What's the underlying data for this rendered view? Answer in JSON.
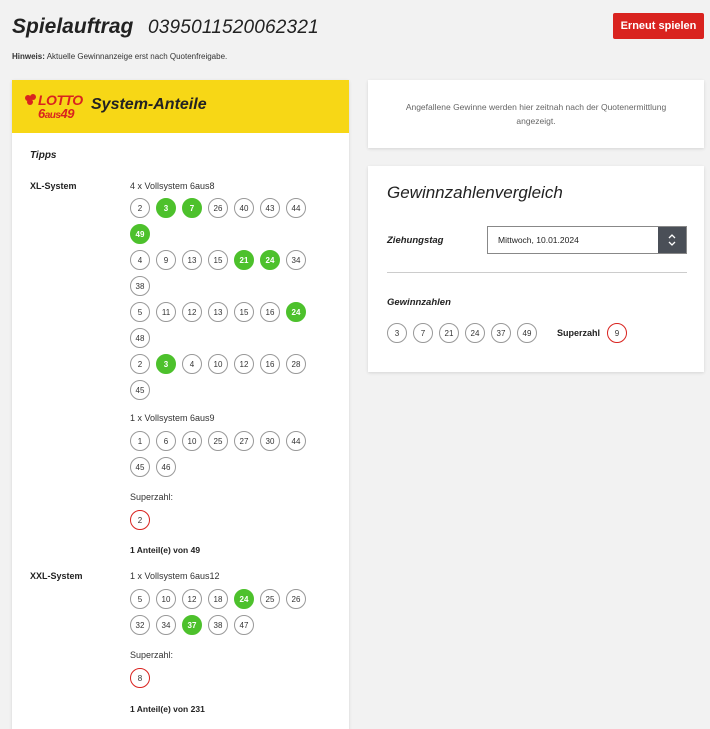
{
  "header": {
    "title": "Spielauftrag",
    "order_number": "0395011520062321",
    "replay_label": "Erneut spielen",
    "hint_bold": "Hinweis:",
    "hint_text": " Aktuelle Gewinnanzeige erst nach Quotenfreigabe."
  },
  "left_card": {
    "logo_word": "LOTTO",
    "logo_six": "6",
    "logo_aus": "aus",
    "logo_49": "49",
    "title": "System-Anteile",
    "tipps_label": "Tipps",
    "xl_label": "XL-System",
    "xl_desc1": "4 x Vollsystem 6aus8",
    "xl_rows": [
      [
        {
          "n": "2",
          "hit": false
        },
        {
          "n": "3",
          "hit": true
        },
        {
          "n": "7",
          "hit": true
        },
        {
          "n": "26",
          "hit": false
        },
        {
          "n": "40",
          "hit": false
        },
        {
          "n": "43",
          "hit": false
        },
        {
          "n": "44",
          "hit": false
        },
        {
          "n": "49",
          "hit": true
        }
      ],
      [
        {
          "n": "4",
          "hit": false
        },
        {
          "n": "9",
          "hit": false
        },
        {
          "n": "13",
          "hit": false
        },
        {
          "n": "15",
          "hit": false
        },
        {
          "n": "21",
          "hit": true
        },
        {
          "n": "24",
          "hit": true
        },
        {
          "n": "34",
          "hit": false
        },
        {
          "n": "38",
          "hit": false
        }
      ],
      [
        {
          "n": "5",
          "hit": false
        },
        {
          "n": "11",
          "hit": false
        },
        {
          "n": "12",
          "hit": false
        },
        {
          "n": "13",
          "hit": false
        },
        {
          "n": "15",
          "hit": false
        },
        {
          "n": "16",
          "hit": false
        },
        {
          "n": "24",
          "hit": true
        },
        {
          "n": "48",
          "hit": false
        }
      ],
      [
        {
          "n": "2",
          "hit": false
        },
        {
          "n": "3",
          "hit": true
        },
        {
          "n": "4",
          "hit": false
        },
        {
          "n": "10",
          "hit": false
        },
        {
          "n": "12",
          "hit": false
        },
        {
          "n": "16",
          "hit": false
        },
        {
          "n": "28",
          "hit": false
        },
        {
          "n": "45",
          "hit": false
        }
      ]
    ],
    "xl_desc2": "1 x Vollsystem 6aus9",
    "xl_row9": [
      {
        "n": "1",
        "hit": false
      },
      {
        "n": "6",
        "hit": false
      },
      {
        "n": "10",
        "hit": false
      },
      {
        "n": "25",
        "hit": false
      },
      {
        "n": "27",
        "hit": false
      },
      {
        "n": "30",
        "hit": false
      },
      {
        "n": "44",
        "hit": false
      },
      {
        "n": "45",
        "hit": false
      },
      {
        "n": "46",
        "hit": false
      }
    ],
    "xl_superzahl_label": "Superzahl:",
    "xl_superzahl": "2",
    "xl_share": "1 Anteil(e) von 49",
    "xxl_label": "XXL-System",
    "xxl_desc": "1 x Vollsystem 6aus12",
    "xxl_numbers": [
      {
        "n": "5",
        "hit": false
      },
      {
        "n": "10",
        "hit": false
      },
      {
        "n": "12",
        "hit": false
      },
      {
        "n": "18",
        "hit": false
      },
      {
        "n": "24",
        "hit": true
      },
      {
        "n": "25",
        "hit": false
      },
      {
        "n": "26",
        "hit": false
      },
      {
        "n": "32",
        "hit": false
      },
      {
        "n": "34",
        "hit": false
      },
      {
        "n": "37",
        "hit": true
      },
      {
        "n": "38",
        "hit": false
      },
      {
        "n": "47",
        "hit": false
      }
    ],
    "xxl_superzahl_label": "Superzahl:",
    "xxl_superzahl": "8",
    "xxl_share": "1 Anteil(e) von 231"
  },
  "info_card": {
    "text": "Angefallene Gewinne werden hier zeitnah nach der Quotenermittlung angezeigt."
  },
  "compare": {
    "title": "Gewinnzahlenvergleich",
    "draw_label": "Ziehungstag",
    "draw_value": "Mittwoch, 10.01.2024",
    "numbers_label": "Gewinnzahlen",
    "numbers": [
      "3",
      "7",
      "21",
      "24",
      "37",
      "49"
    ],
    "superzahl_label": "Superzahl",
    "superzahl": "9"
  },
  "colors": {
    "hit": "#4dc12c",
    "brand_red": "#d9231f",
    "brand_yellow": "#f7d716"
  }
}
